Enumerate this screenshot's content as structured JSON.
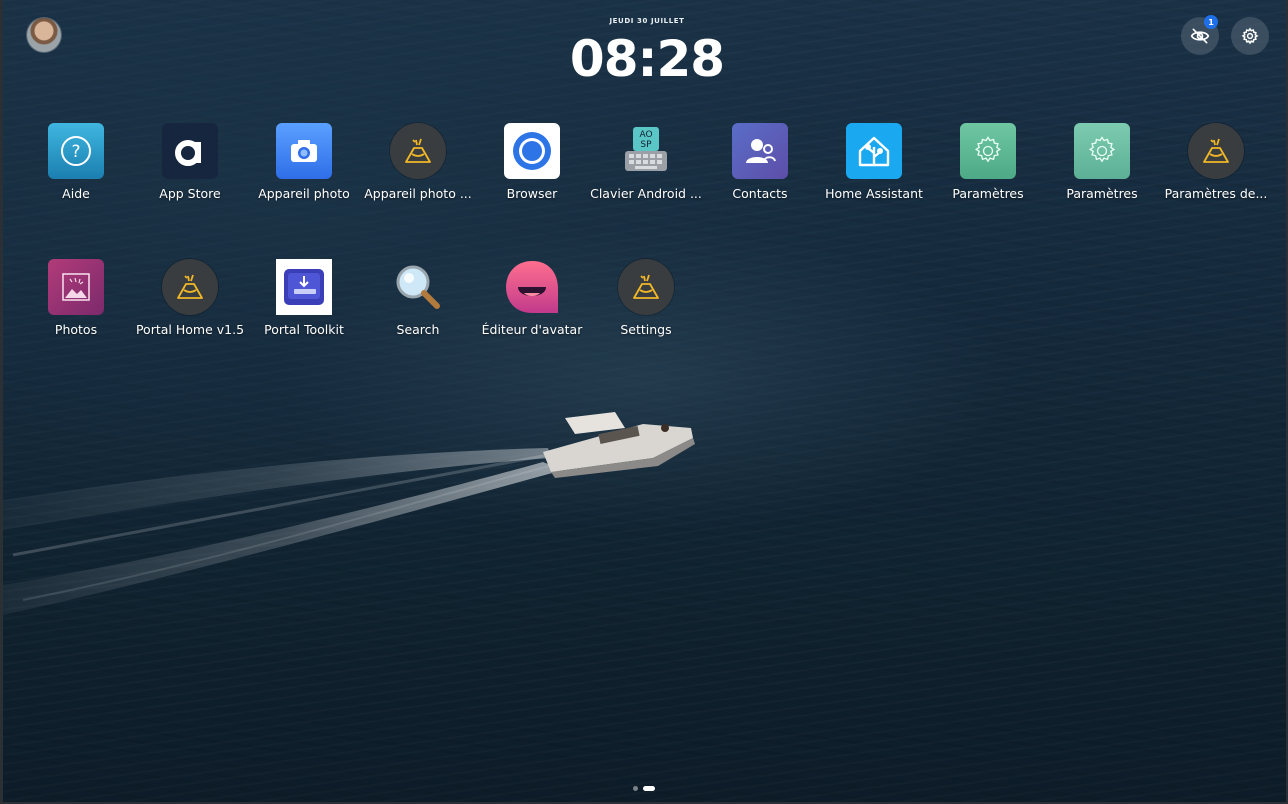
{
  "status": {
    "date": "JEUDI 30 JUILLET",
    "time": "08:28",
    "notification_count": "1"
  },
  "apps": [
    {
      "label": "Aide",
      "icon": "help-icon"
    },
    {
      "label": "App Store",
      "icon": "app-store-icon"
    },
    {
      "label": "Appareil photo",
      "icon": "camera-icon"
    },
    {
      "label": "Appareil photo ...",
      "icon": "volcano-icon"
    },
    {
      "label": "Browser",
      "icon": "browser-icon"
    },
    {
      "label": "Clavier Android ...",
      "icon": "keyboard-icon"
    },
    {
      "label": "Contacts",
      "icon": "contacts-icon"
    },
    {
      "label": "Home Assistant",
      "icon": "home-assistant-icon"
    },
    {
      "label": "Paramètres",
      "icon": "settings-gear-icon"
    },
    {
      "label": "Paramètres",
      "icon": "settings-gear-icon"
    },
    {
      "label": "Paramètres de...",
      "icon": "volcano-icon"
    },
    {
      "label": "Photos",
      "icon": "photos-icon"
    },
    {
      "label": "Portal Home v1.5",
      "icon": "volcano-icon"
    },
    {
      "label": "Portal Toolkit",
      "icon": "toolkit-icon"
    },
    {
      "label": "Search",
      "icon": "magnifier-icon"
    },
    {
      "label": "Éditeur d'avatar",
      "icon": "avatar-editor-icon"
    },
    {
      "label": "Settings",
      "icon": "volcano-icon"
    }
  ],
  "pages": {
    "count": 2,
    "active": 2
  },
  "colors": {
    "notification_badge": "#1e6fe8",
    "water": "#14293b"
  }
}
